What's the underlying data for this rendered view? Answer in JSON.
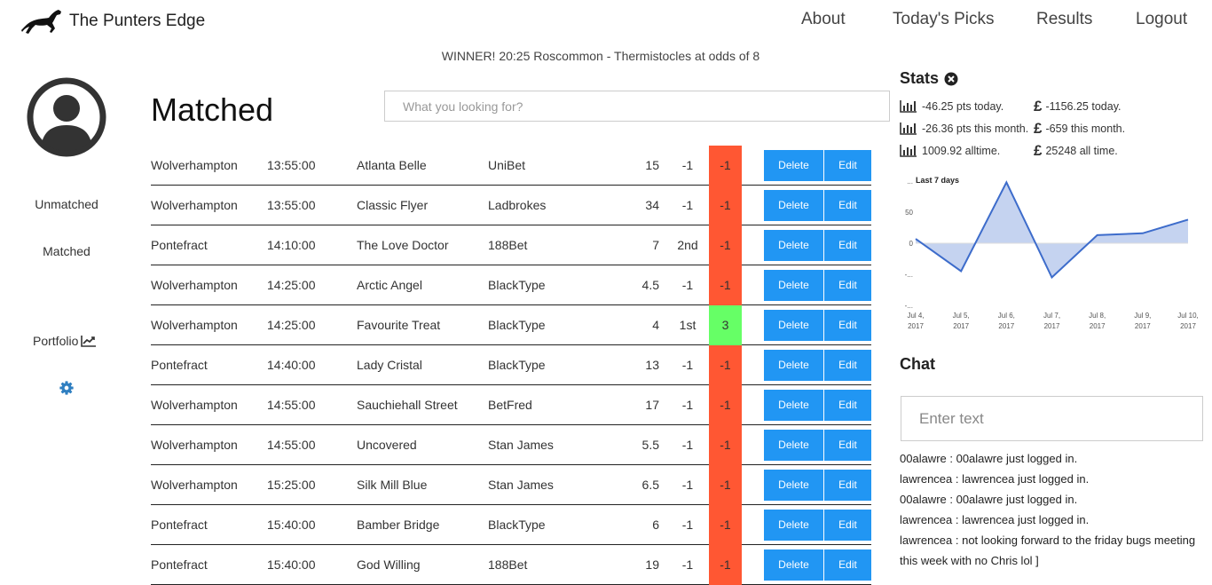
{
  "app": {
    "brand": "The Punters Edge",
    "nav": [
      "About",
      "Today's Picks",
      "Results",
      "Logout"
    ]
  },
  "banner": "WINNER! 20:25 Roscommon - Thermistocles at odds of 8",
  "sidebar": {
    "items": [
      "Unmatched",
      "Matched",
      "Portfolio"
    ]
  },
  "main": {
    "title": "Matched",
    "search_placeholder": "What you looking for?",
    "delete_label": "Delete",
    "edit_label": "Edit",
    "rows": [
      {
        "track": "Wolverhampton",
        "time": "13:55:00",
        "horse": "Atlanta Belle",
        "bookie": "UniBet",
        "odds": "15",
        "pos": "-1",
        "pts": "-1",
        "win": false
      },
      {
        "track": "Wolverhampton",
        "time": "13:55:00",
        "horse": "Classic Flyer",
        "bookie": "Ladbrokes",
        "odds": "34",
        "pos": "-1",
        "pts": "-1",
        "win": false
      },
      {
        "track": "Pontefract",
        "time": "14:10:00",
        "horse": "The Love Doctor",
        "bookie": "188Bet",
        "odds": "7",
        "pos": "2nd",
        "pts": "-1",
        "win": false
      },
      {
        "track": "Wolverhampton",
        "time": "14:25:00",
        "horse": "Arctic Angel",
        "bookie": "BlackType",
        "odds": "4.5",
        "pos": "-1",
        "pts": "-1",
        "win": false
      },
      {
        "track": "Wolverhampton",
        "time": "14:25:00",
        "horse": "Favourite Treat",
        "bookie": "BlackType",
        "odds": "4",
        "pos": "1st",
        "pts": "3",
        "win": true
      },
      {
        "track": "Pontefract",
        "time": "14:40:00",
        "horse": "Lady Cristal",
        "bookie": "BlackType",
        "odds": "13",
        "pos": "-1",
        "pts": "-1",
        "win": false
      },
      {
        "track": "Wolverhampton",
        "time": "14:55:00",
        "horse": "Sauchiehall Street",
        "bookie": "BetFred",
        "odds": "17",
        "pos": "-1",
        "pts": "-1",
        "win": false
      },
      {
        "track": "Wolverhampton",
        "time": "14:55:00",
        "horse": "Uncovered",
        "bookie": "Stan James",
        "odds": "5.5",
        "pos": "-1",
        "pts": "-1",
        "win": false
      },
      {
        "track": "Wolverhampton",
        "time": "15:25:00",
        "horse": "Silk Mill Blue",
        "bookie": "Stan James",
        "odds": "6.5",
        "pos": "-1",
        "pts": "-1",
        "win": false
      },
      {
        "track": "Pontefract",
        "time": "15:40:00",
        "horse": "Bamber Bridge",
        "bookie": "BlackType",
        "odds": "6",
        "pos": "-1",
        "pts": "-1",
        "win": false
      },
      {
        "track": "Pontefract",
        "time": "15:40:00",
        "horse": "God Willing",
        "bookie": "188Bet",
        "odds": "19",
        "pos": "-1",
        "pts": "-1",
        "win": false
      }
    ]
  },
  "stats": {
    "title": "Stats",
    "pts": [
      "-46.25 pts today.",
      "-26.36 pts this month.",
      "1009.92 alltime."
    ],
    "money": [
      "-1156.25 today.",
      "-659 this month.",
      "25248 all time."
    ],
    "pound_symbol": "£"
  },
  "chart_data": {
    "type": "area",
    "title": "Last 7 days",
    "x": [
      "Jul 4, 2017",
      "Jul 5, 2017",
      "Jul 6, 2017",
      "Jul 7, 2017",
      "Jul 8, 2017",
      "Jul 9, 2017",
      "Jul 10, 2017"
    ],
    "values": [
      7,
      -45,
      98,
      -55,
      13,
      16,
      38
    ],
    "y_ticks": [
      "...",
      "50",
      "0",
      "-...",
      "-..."
    ],
    "ylim": [
      -100,
      100
    ],
    "fill_color": "#c5d3f0",
    "line_color": "#3d6ccb"
  },
  "chat": {
    "title": "Chat",
    "placeholder": "Enter text",
    "messages": [
      "00alawre : 00alawre just logged in.",
      "lawrencea : lawrencea just logged in.",
      "00alawre : 00alawre just logged in.",
      "lawrencea : lawrencea just logged in.",
      "lawrencea : not looking forward to the friday bugs meeting this week with no Chris lol ]"
    ]
  },
  "colors": {
    "accent": "#2196f3",
    "loss": "#ff5733",
    "win": "#66ff66"
  }
}
